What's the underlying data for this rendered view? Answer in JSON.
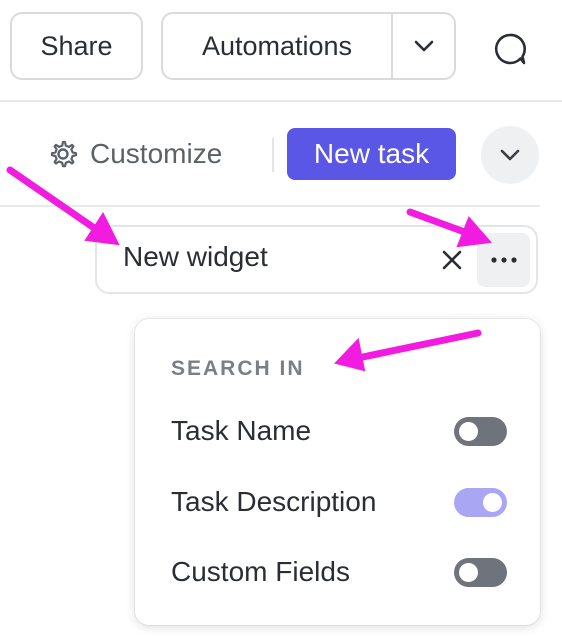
{
  "toolbar": {
    "share_label": "Share",
    "automations_label": "Automations",
    "customize_label": "Customize",
    "new_task_label": "New task"
  },
  "search": {
    "value": "New widget"
  },
  "search_options": {
    "title": "SEARCH IN",
    "items": [
      {
        "label": "Task Name",
        "enabled": false
      },
      {
        "label": "Task Description",
        "enabled": true
      },
      {
        "label": "Custom Fields",
        "enabled": false
      }
    ]
  },
  "colors": {
    "accent": "#5b57e6",
    "annotation_arrow": "#f21ce0",
    "toggle_on": "#a9a7f3",
    "toggle_off": "#6f747c"
  },
  "icons": [
    "chevron-down-icon",
    "chat-bubble-icon",
    "gear-icon",
    "close-icon",
    "more-horizontal-icon"
  ]
}
